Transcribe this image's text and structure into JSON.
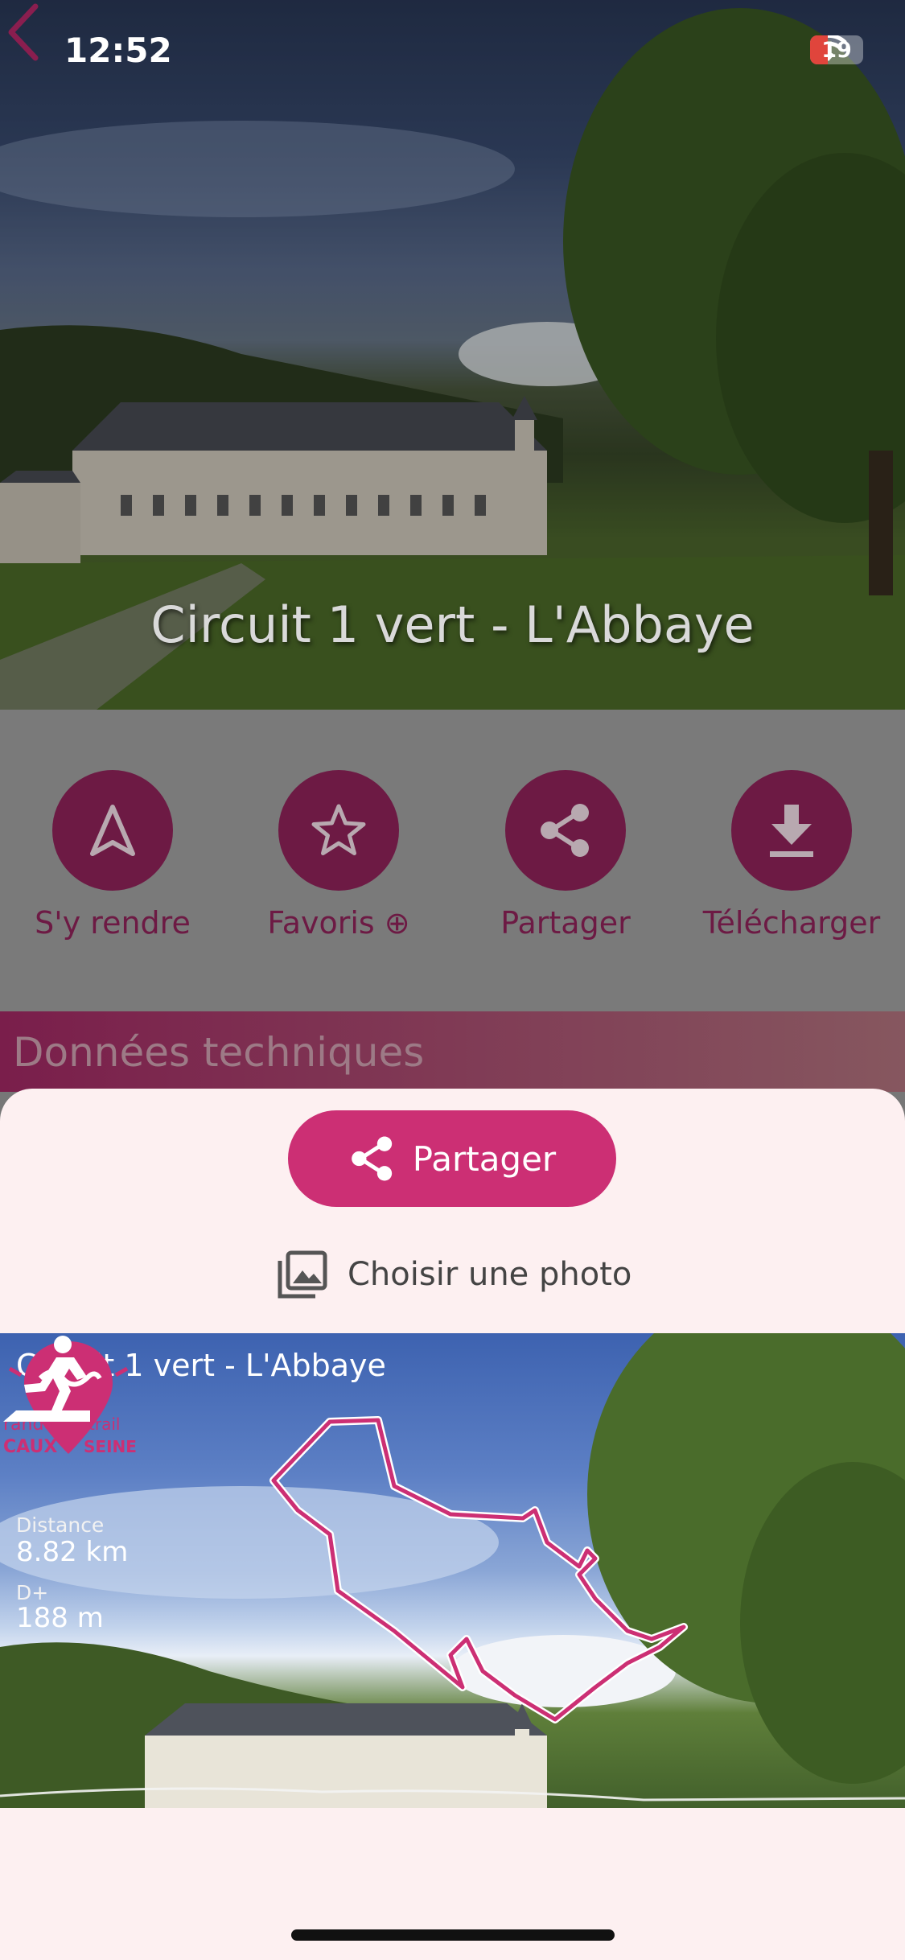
{
  "status_bar": {
    "time": "12:52",
    "battery": "19"
  },
  "hero": {
    "title": "Circuit 1 vert - L'Abbaye",
    "back_icon": "chevron-left-icon"
  },
  "actions": [
    {
      "label": "S'y rendre",
      "icon": "navigate-arrow-icon"
    },
    {
      "label": "Favoris ⊕",
      "icon": "star-outline-icon"
    },
    {
      "label": "Partager",
      "icon": "share-icon"
    },
    {
      "label": "Télécharger",
      "icon": "download-icon"
    }
  ],
  "tech_section": {
    "title": "Données techniques"
  },
  "sheet": {
    "share_button": {
      "label": "Partager",
      "icon": "share-icon"
    },
    "choose_photo": {
      "label": "Choisir une photo",
      "icon": "photo-library-icon"
    },
    "preview": {
      "title": "Circuit 1 vert - L'Abbaye",
      "distance_label": "Distance",
      "distance_value": "8.82 km",
      "elevation_label": "D+",
      "elevation_value": "188 m",
      "logo_text_top": "rando trail",
      "logo_text_bottom": "CAUX SEINE"
    }
  },
  "colors": {
    "accent": "#cc2f74",
    "dark_accent": "#6d1a44",
    "sheet_bg": "#fdf0f1"
  }
}
